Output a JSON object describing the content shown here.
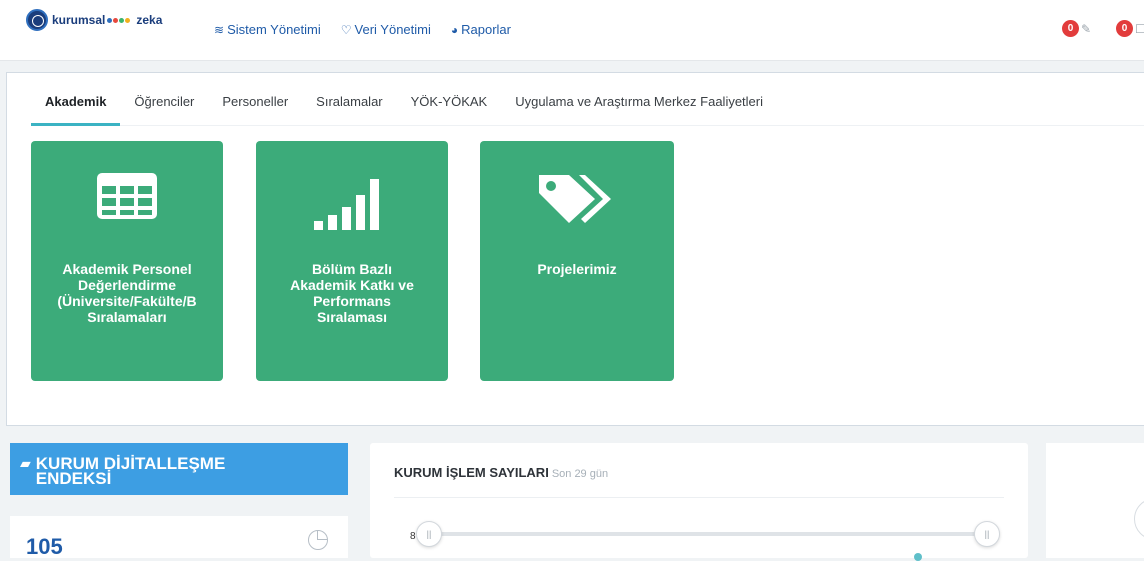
{
  "header": {
    "logo_left": "kurumsal",
    "logo_right": "zeka",
    "nav": [
      {
        "label": "Sistem Yönetimi",
        "icon": "layers-icon"
      },
      {
        "label": "Veri Yönetimi",
        "icon": "hand-icon"
      },
      {
        "label": "Raporlar",
        "icon": "pie-chart-icon"
      }
    ],
    "notifications": [
      {
        "count": "0"
      },
      {
        "count": "0"
      }
    ]
  },
  "tabs": [
    "Akademik",
    "Öğrenciler",
    "Personeller",
    "Sıralamalar",
    "YÖK-YÖKAK",
    "Uygulama ve Araştırma Merkez Faaliyetleri"
  ],
  "active_tab": "Akademik",
  "cards": [
    {
      "title": "Akademik Personel\nDeğerlendirme\n(Üniversite/Fakülte/B\nSıralamaları",
      "icon": "table-icon"
    },
    {
      "title": "Bölüm Bazlı\nAkademik Katkı ve\nPerformans\nSıralaması",
      "icon": "signal-bars-icon"
    },
    {
      "title": "Projelerimiz",
      "icon": "tags-icon"
    }
  ],
  "digital_index": {
    "title_line1": "KURUM DİJİTALLEŞME",
    "title_line2": "ENDEKSİ",
    "value": "105"
  },
  "transactions": {
    "title": "KURUM İŞLEM SAYILARI",
    "subtitle": "Son 29 gün",
    "slider_label": "8"
  },
  "colors": {
    "card_green": "#3cab7a",
    "digital_blue": "#3d9ee3",
    "accent_teal": "#3bb3c3",
    "badge_red": "#e23c3c"
  }
}
